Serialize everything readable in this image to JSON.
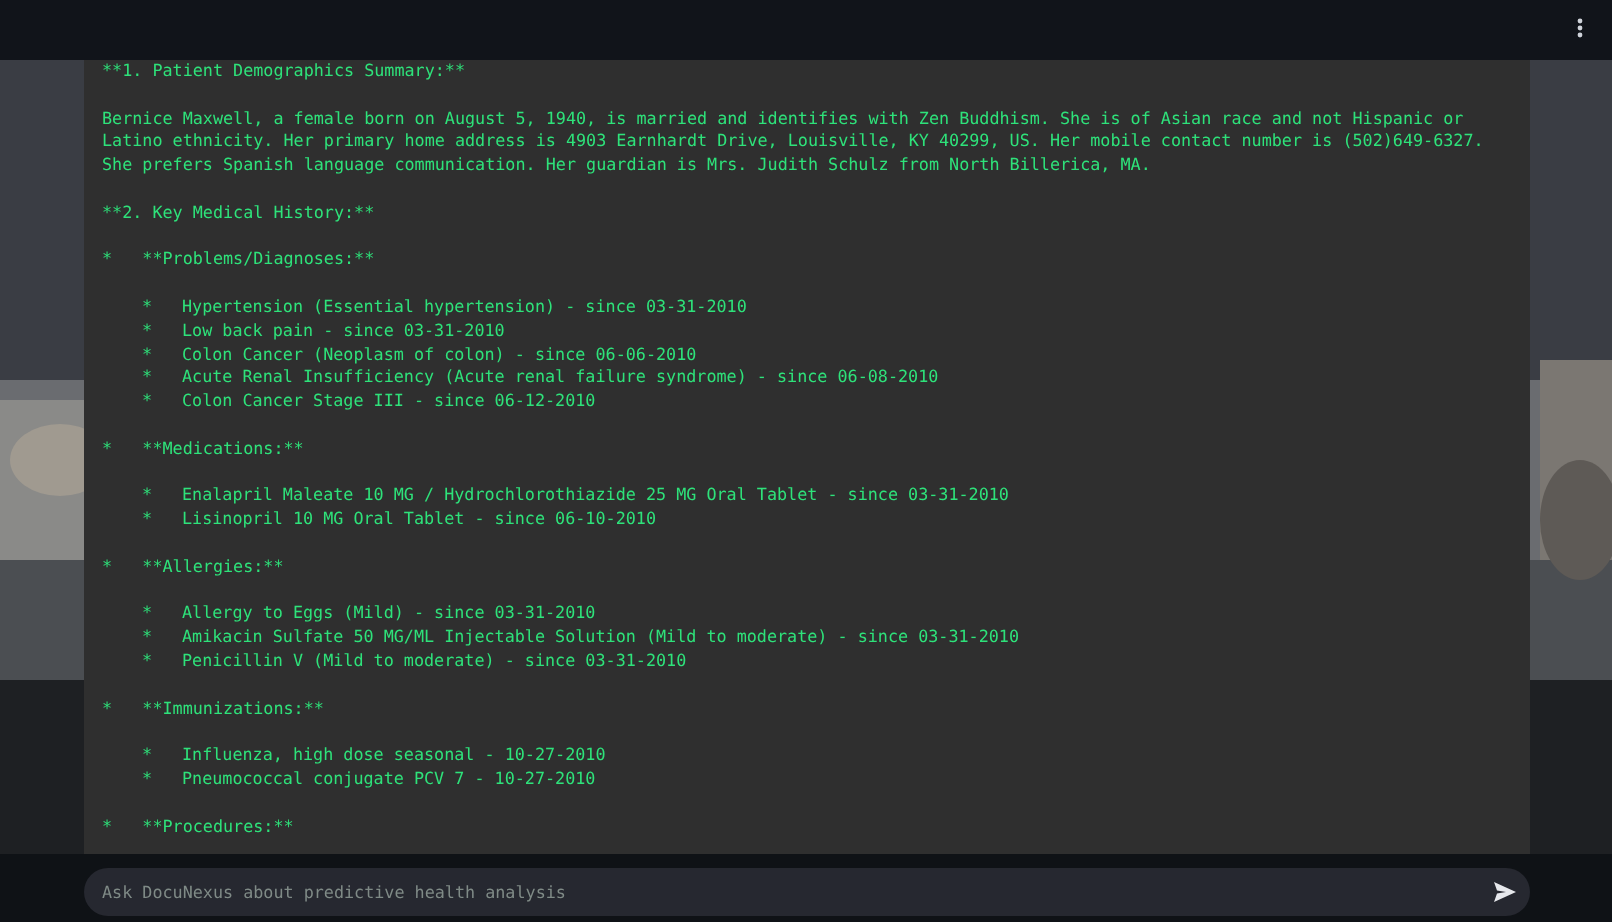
{
  "sections": [
    {
      "heading": "**1. Patient Demographics Summary:**",
      "paragraph": "Bernice Maxwell, a female born on August 5, 1940, is married and identifies with Zen Buddhism. She is of Asian race and not Hispanic or Latino ethnicity. Her primary home address is 4903 Earnhardt Drive, Louisville, KY 40299, US. Her mobile contact number is (502)649-6327. She prefers Spanish language communication. Her guardian is Mrs. Judith Schulz from North Billerica, MA."
    },
    {
      "heading": "**2. Key Medical History:**",
      "groups": [
        {
          "label": "*   **Problems/Diagnoses:**",
          "items": [
            {
              "marker": "*",
              "text": "Hypertension (Essential hypertension) - since 03-31-2010"
            },
            {
              "marker": "*",
              "text": "Low back pain - since 03-31-2010"
            },
            {
              "marker": "*",
              "text": "Colon Cancer (Neoplasm of colon) - since 06-06-2010"
            },
            {
              "marker": "*",
              "text": "Acute Renal Insufficiency (Acute renal failure syndrome) - since 06-08-2010"
            },
            {
              "marker": "*",
              "text": "Colon Cancer Stage III - since 06-12-2010"
            }
          ]
        },
        {
          "label": "*   **Medications:**",
          "items": [
            {
              "marker": "*",
              "text": "Enalapril Maleate 10 MG / Hydrochlorothiazide 25 MG Oral Tablet - since 03-31-2010"
            },
            {
              "marker": "*",
              "text": "Lisinopril 10 MG Oral Tablet - since 06-10-2010"
            }
          ]
        },
        {
          "label": "*   **Allergies:**",
          "items": [
            {
              "marker": "*",
              "text": "Allergy to Eggs (Mild) - since 03-31-2010"
            },
            {
              "marker": "*",
              "text": "Amikacin Sulfate 50 MG/ML Injectable Solution (Mild to moderate) - since 03-31-2010"
            },
            {
              "marker": "*",
              "text": "Penicillin V (Mild to moderate) - since 03-31-2010"
            }
          ]
        },
        {
          "label": "*   **Immunizations:**",
          "items": [
            {
              "marker": "*",
              "text": "Influenza, high dose seasonal - 10-27-2010"
            },
            {
              "marker": "*",
              "text": "Pneumococcal conjugate PCV 7 - 10-27-2010"
            }
          ]
        },
        {
          "label": "*   **Procedures:**"
        }
      ]
    }
  ],
  "chat_input": {
    "placeholder": "Ask DocuNexus about predictive health analysis"
  }
}
